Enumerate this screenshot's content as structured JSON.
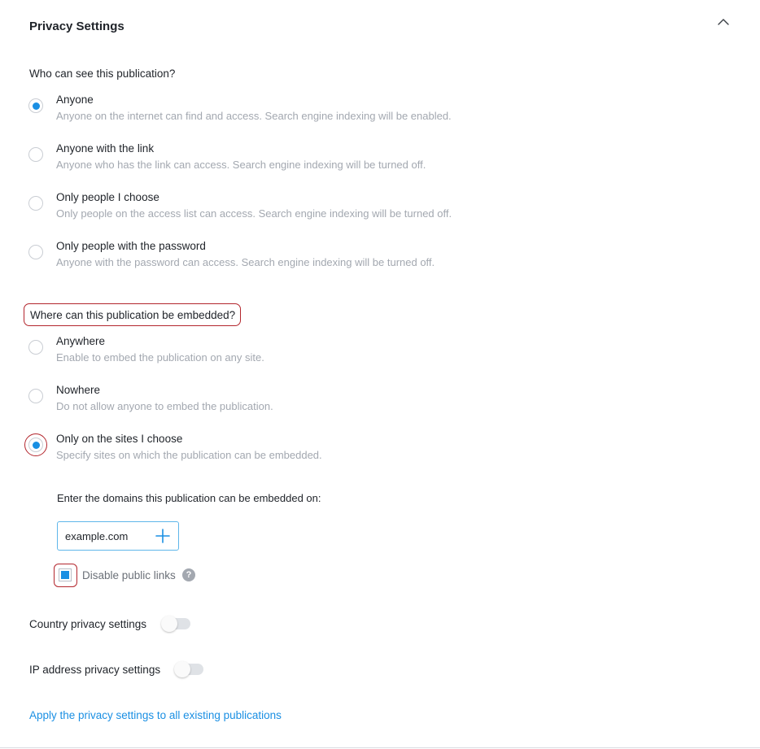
{
  "panel": {
    "title": "Privacy Settings",
    "collapse_icon": "chevron-up-icon"
  },
  "visibility": {
    "question": "Who can see this publication?",
    "selected": "Anyone",
    "options": [
      {
        "label": "Anyone",
        "description": "Anyone on the internet can find and access. Search engine indexing will be enabled.",
        "checked": true
      },
      {
        "label": "Anyone with the link",
        "description": "Anyone who has the link can access. Search engine indexing will be turned off.",
        "checked": false
      },
      {
        "label": "Only people I choose",
        "description": "Only people on the access list can access. Search engine indexing will be turned off.",
        "checked": false
      },
      {
        "label": "Only people with the password",
        "description": "Anyone with the password can access. Search engine indexing will be turned off.",
        "checked": false
      }
    ]
  },
  "embedding": {
    "question": "Where can this publication be embedded?",
    "selected": "Only on the sites I choose",
    "options": [
      {
        "label": "Anywhere",
        "description": "Enable to embed the publication on any site.",
        "checked": false
      },
      {
        "label": "Nowhere",
        "description": "Do not allow anyone to embed the publication.",
        "checked": false
      },
      {
        "label": "Only on the sites I choose",
        "description": "Specify sites on which the publication can be embedded.",
        "checked": true
      }
    ],
    "domains_label": "Enter the domains this publication can be embedded on:",
    "domain_value": "example.com",
    "add_icon": "plus-icon",
    "disable_public_links": {
      "label": "Disable public links",
      "checked": true,
      "help_icon": "question-mark-icon",
      "help_glyph": "?"
    }
  },
  "country_privacy": {
    "label": "Country privacy settings",
    "enabled": false
  },
  "ip_privacy": {
    "label": "IP address privacy settings",
    "enabled": false
  },
  "apply_link": "Apply the privacy settings to all existing publications",
  "colors": {
    "accent": "#1a8fe3",
    "highlight": "#b3262d",
    "muted_text": "#a3a8b0"
  }
}
